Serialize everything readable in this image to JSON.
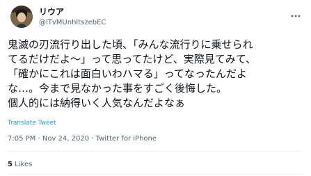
{
  "tweet": {
    "display_name": "リウア",
    "handle": "@lTvMUnhltszebEC",
    "body_lines": [
      "鬼滅の刃流行り出した頃、「みんな流行りに乗せられ",
      "てるだけだよ〜」って思ってたけど、実際見てみて、",
      "「確かにこれは面白いわハマる」ってなったんだよ",
      "な…。今まで見なかった事をすごく後悔した。",
      "個人的には納得いく人気なんだよなぁ"
    ],
    "translate_label": "Translate Tweet",
    "time": "7:05 PM",
    "separator": "·",
    "date": "Nov 24, 2020",
    "source": "Twitter for iPhone",
    "likes_count": "5",
    "likes_label": "Likes"
  },
  "icons": {
    "avatar": "avatar-image",
    "more": "more-options-icon"
  },
  "colors": {
    "text": "#0f1419",
    "secondary": "#536471",
    "link": "#1d9bf0",
    "divider": "#eff3f4"
  }
}
